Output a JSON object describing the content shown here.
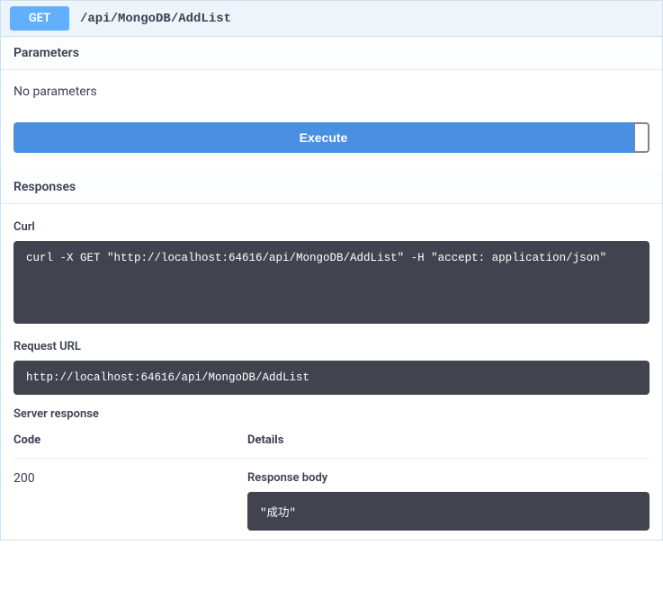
{
  "summary": {
    "method": "GET",
    "path": "/api/MongoDB/AddList"
  },
  "sections": {
    "parameters_heading": "Parameters",
    "no_parameters_text": "No parameters",
    "execute_label": "Execute",
    "responses_heading": "Responses"
  },
  "curl": {
    "heading": "Curl",
    "command": "curl -X GET \"http://localhost:64616/api/MongoDB/AddList\" -H \"accept: application/json\""
  },
  "request_url": {
    "heading": "Request URL",
    "value": "http://localhost:64616/api/MongoDB/AddList"
  },
  "server_response": {
    "heading": "Server response",
    "columns": {
      "code": "Code",
      "details": "Details"
    },
    "status_code": "200",
    "response_body_label": "Response body",
    "response_body_value": "\"成功\""
  }
}
